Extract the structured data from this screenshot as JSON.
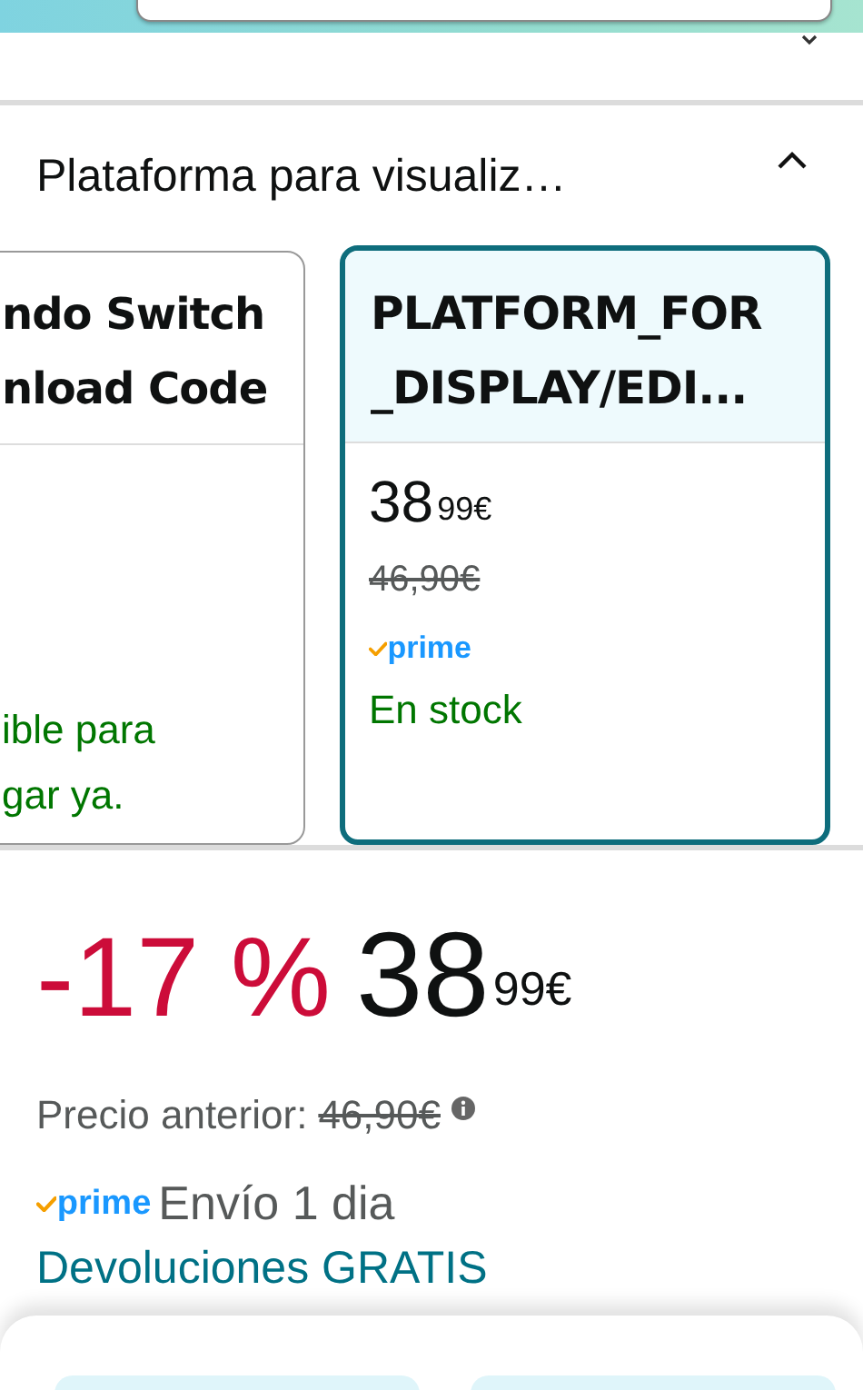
{
  "section": {
    "title": "Plataforma para visualiz…",
    "expanded": true
  },
  "options": [
    {
      "title_lines": [
        "ndo Switch",
        "nload Code"
      ],
      "availability_lines": [
        "ible para",
        "gar ya."
      ],
      "selected": false
    },
    {
      "title_lines": [
        "PLATFORM_FOR",
        "_DISPLAY/EDI..."
      ],
      "price": {
        "whole": "38",
        "fraction": "99",
        "currency": "€"
      },
      "list_price": "46,90€",
      "prime": "prime",
      "availability_lines": [
        "En stock"
      ],
      "selected": true
    }
  ],
  "offer": {
    "discount": "-17 %",
    "price": {
      "whole": "38",
      "fraction": "99",
      "currency": "€"
    },
    "previous_label": "Precio anterior:",
    "previous_price": "46,90€",
    "prime": "prime",
    "delivery": "Envío 1 dia",
    "returns": "Devoluciones GRATIS"
  }
}
